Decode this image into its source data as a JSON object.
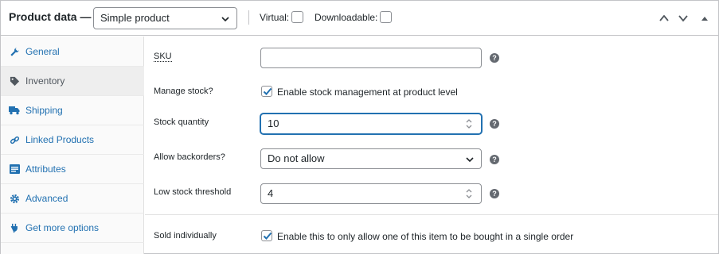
{
  "header": {
    "title": "Product data —",
    "product_type": "Simple product",
    "virtual_label": "Virtual:",
    "downloadable_label": "Downloadable:"
  },
  "sidebar": {
    "tabs": [
      {
        "label": "General",
        "icon": "wrench-icon",
        "active": false
      },
      {
        "label": "Inventory",
        "icon": "tag-icon",
        "active": true
      },
      {
        "label": "Shipping",
        "icon": "truck-icon",
        "active": false
      },
      {
        "label": "Linked Products",
        "icon": "link-icon",
        "active": false
      },
      {
        "label": "Attributes",
        "icon": "list-icon",
        "active": false
      },
      {
        "label": "Advanced",
        "icon": "gear-icon",
        "active": false
      },
      {
        "label": "Get more options",
        "icon": "plug-icon",
        "active": false
      }
    ]
  },
  "fields": {
    "sku": {
      "label": "SKU",
      "value": ""
    },
    "manage_stock": {
      "label": "Manage stock?",
      "checkbox_label": "Enable stock management at product level",
      "checked": true
    },
    "stock_quantity": {
      "label": "Stock quantity",
      "value": "10"
    },
    "allow_backorders": {
      "label": "Allow backorders?",
      "value": "Do not allow"
    },
    "low_stock": {
      "label": "Low stock threshold",
      "value": "4"
    },
    "sold_individually": {
      "label": "Sold individually",
      "checkbox_label": "Enable this to only allow one of this item to be bought in a single order",
      "checked": true
    }
  },
  "help_glyph": "?",
  "colors": {
    "link": "#2271b1",
    "border": "#8c8f94",
    "focus": "#2271b1"
  }
}
